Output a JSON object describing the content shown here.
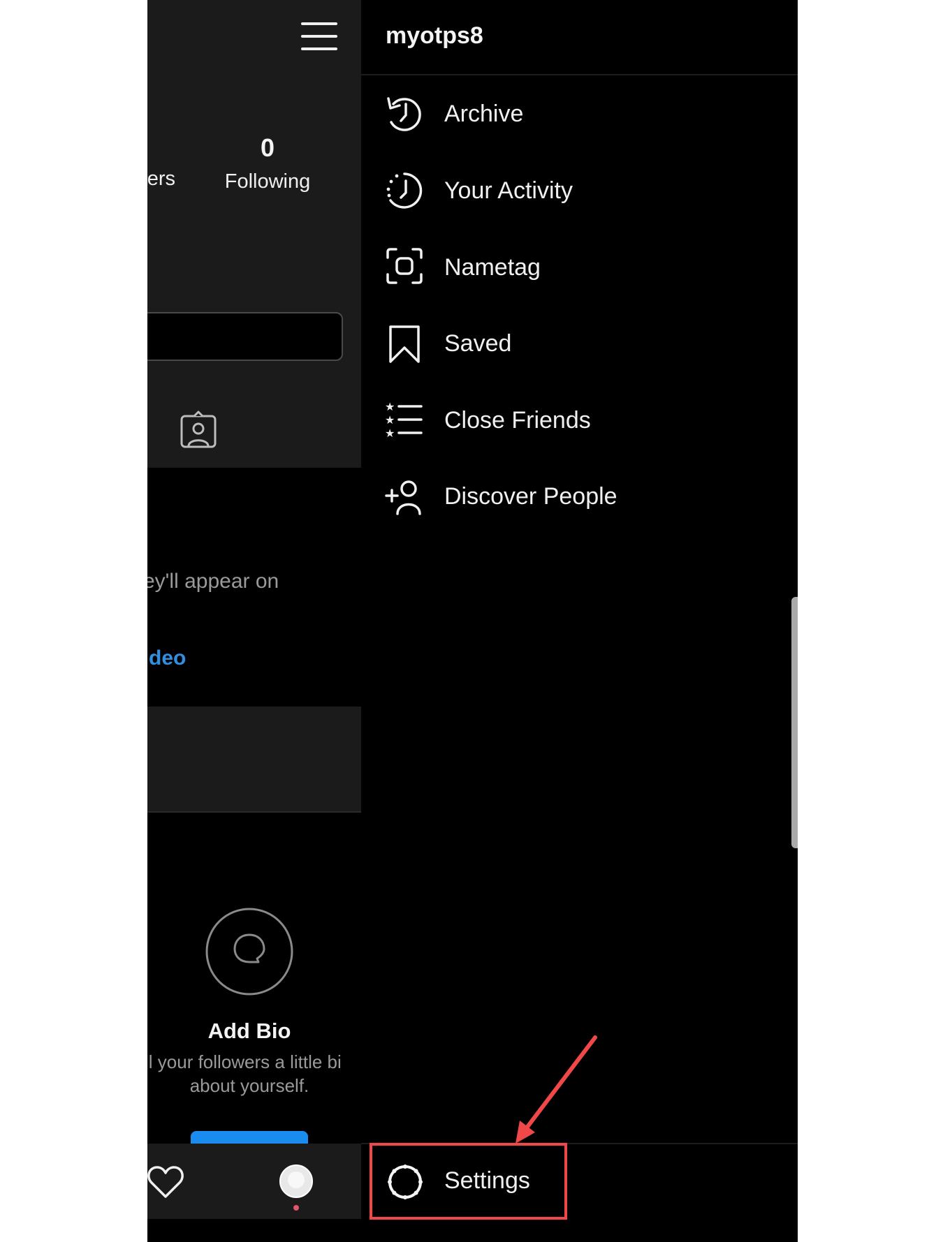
{
  "profile": {
    "followers_label_partial": "ers",
    "following_count": "0",
    "following_label": "Following",
    "empty_posts_text_partial": "ey'll appear on",
    "empty_posts_link_partial": "deo",
    "add_bio_title": "Add Bio",
    "add_bio_line1": "ll your followers a little bi",
    "add_bio_line2": "about yourself."
  },
  "drawer": {
    "username": "myotps8",
    "items": [
      {
        "label": "Archive",
        "icon": "archive-icon"
      },
      {
        "label": "Your Activity",
        "icon": "activity-icon"
      },
      {
        "label": "Nametag",
        "icon": "nametag-icon"
      },
      {
        "label": "Saved",
        "icon": "bookmark-icon"
      },
      {
        "label": "Close Friends",
        "icon": "close-friends-icon"
      },
      {
        "label": "Discover People",
        "icon": "add-person-icon"
      }
    ],
    "settings_label": "Settings"
  },
  "bottom_nav": {
    "icons": [
      "heart-icon",
      "profile-avatar"
    ]
  },
  "annotation": {
    "color": "#f04848",
    "target": "Settings"
  },
  "colors": {
    "link_blue": "#2f8fe0",
    "drawer_bg": "#000000",
    "profile_bg": "#1b1b1b"
  }
}
